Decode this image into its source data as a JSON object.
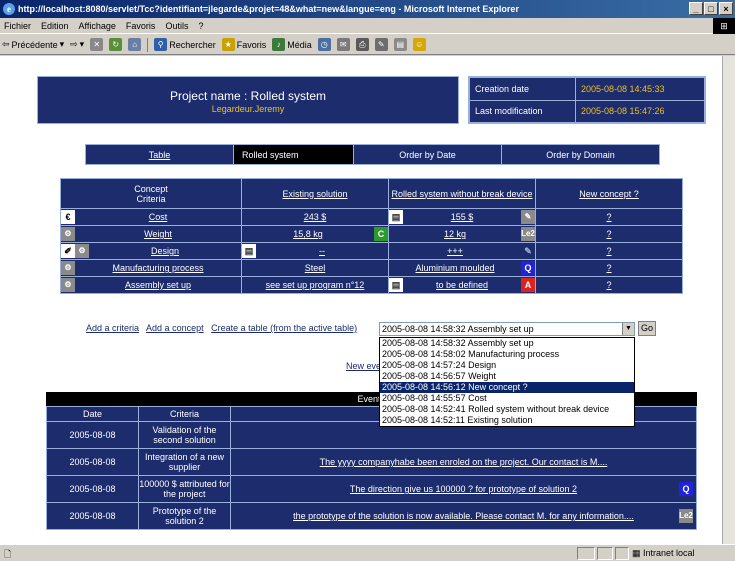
{
  "window": {
    "title": "http://localhost:8080/servlet/Tcc?identifiant=jlegarde&projet=48&what=new&langue=eng - Microsoft Internet Explorer",
    "controls": [
      "_",
      "□",
      "×"
    ]
  },
  "menu": [
    "Fichier",
    "Edition",
    "Affichage",
    "Favoris",
    "Outils",
    "?"
  ],
  "toolbar": {
    "back": "Précédente",
    "search": "Rechercher",
    "favorites": "Favoris",
    "media": "Média"
  },
  "project": {
    "name": "Project name : Rolled system",
    "author": "Legardeur.Jeremy",
    "creation_label": "Creation date",
    "creation_value": "2005-08-08 14:45:33",
    "modif_label": "Last modification",
    "modif_value": "2005-08-08 15:47:26"
  },
  "tabs": [
    "Table",
    "Rolled system",
    "Order by Date",
    "Order by Domain"
  ],
  "table": {
    "head": {
      "criteria": [
        "Concept",
        "Criteria"
      ],
      "existing": "Existing solution",
      "rolled": "Rolled system without break device",
      "newconcept": "New concept ?"
    },
    "rows": [
      {
        "criterion": "Cost",
        "existing": "243 $",
        "rolled": "155 $",
        "newc": "?"
      },
      {
        "criterion": "Weight",
        "existing": "15,8 kg",
        "rolled": "12 kg",
        "newc": "?"
      },
      {
        "criterion": "Design",
        "existing": "--",
        "rolled": "+++",
        "newc": "?"
      },
      {
        "criterion": "Manufacturing process",
        "existing": "Steel",
        "rolled": "Aluminium moulded",
        "newc": "?"
      },
      {
        "criterion": "Assembly set up",
        "existing": "see set up program n°12",
        "rolled": "to be defined",
        "newc": "?"
      }
    ],
    "badges": {
      "c": "C",
      "le2": "Le2",
      "q": "Q",
      "a": "A",
      "euro": "€"
    }
  },
  "actions": {
    "add_criteria": "Add a criteria",
    "add_concept": "Add a concept",
    "create_table": "Create a table (from the active table)",
    "select_value": "2005-08-08 14:58:32 Assembly set up",
    "go": "Go",
    "new_event": "New eve"
  },
  "dropdown": [
    "2005-08-08 14:58:32 Assembly set up",
    "2005-08-08 14:58:02 Manufacturing process",
    "2005-08-08 14:57:24 Design",
    "2005-08-08 14:56:57 Weight",
    "2005-08-08 14:56:12 New concept ?",
    "2005-08-08 14:55:57 Cost",
    "2005-08-08 14:52:41 Rolled system without break device",
    "2005-08-08 14:52:11 Existing solution"
  ],
  "events": {
    "title": "Event t",
    "headers": [
      "Date",
      "Criteria",
      ""
    ],
    "rows": [
      {
        "date": "2005-08-08",
        "criteria": "Validation of the second solution",
        "text": ""
      },
      {
        "date": "2005-08-08",
        "criteria": "Integration of a new supplier",
        "text": "The yyyy companyhabe been enroled on the project. Our contact is M...."
      },
      {
        "date": "2005-08-08",
        "criteria": "100000 $ attributed for the project",
        "text": "The direction give us 100000 ? for prototype of solution 2",
        "badge": "Q"
      },
      {
        "date": "2005-08-08",
        "criteria": "Prototype of the solution 2",
        "text": "the prototype of the solution is now available. Please contact M. for any information....",
        "badge": "Le2"
      }
    ]
  },
  "status": {
    "zone": "Intranet local"
  }
}
